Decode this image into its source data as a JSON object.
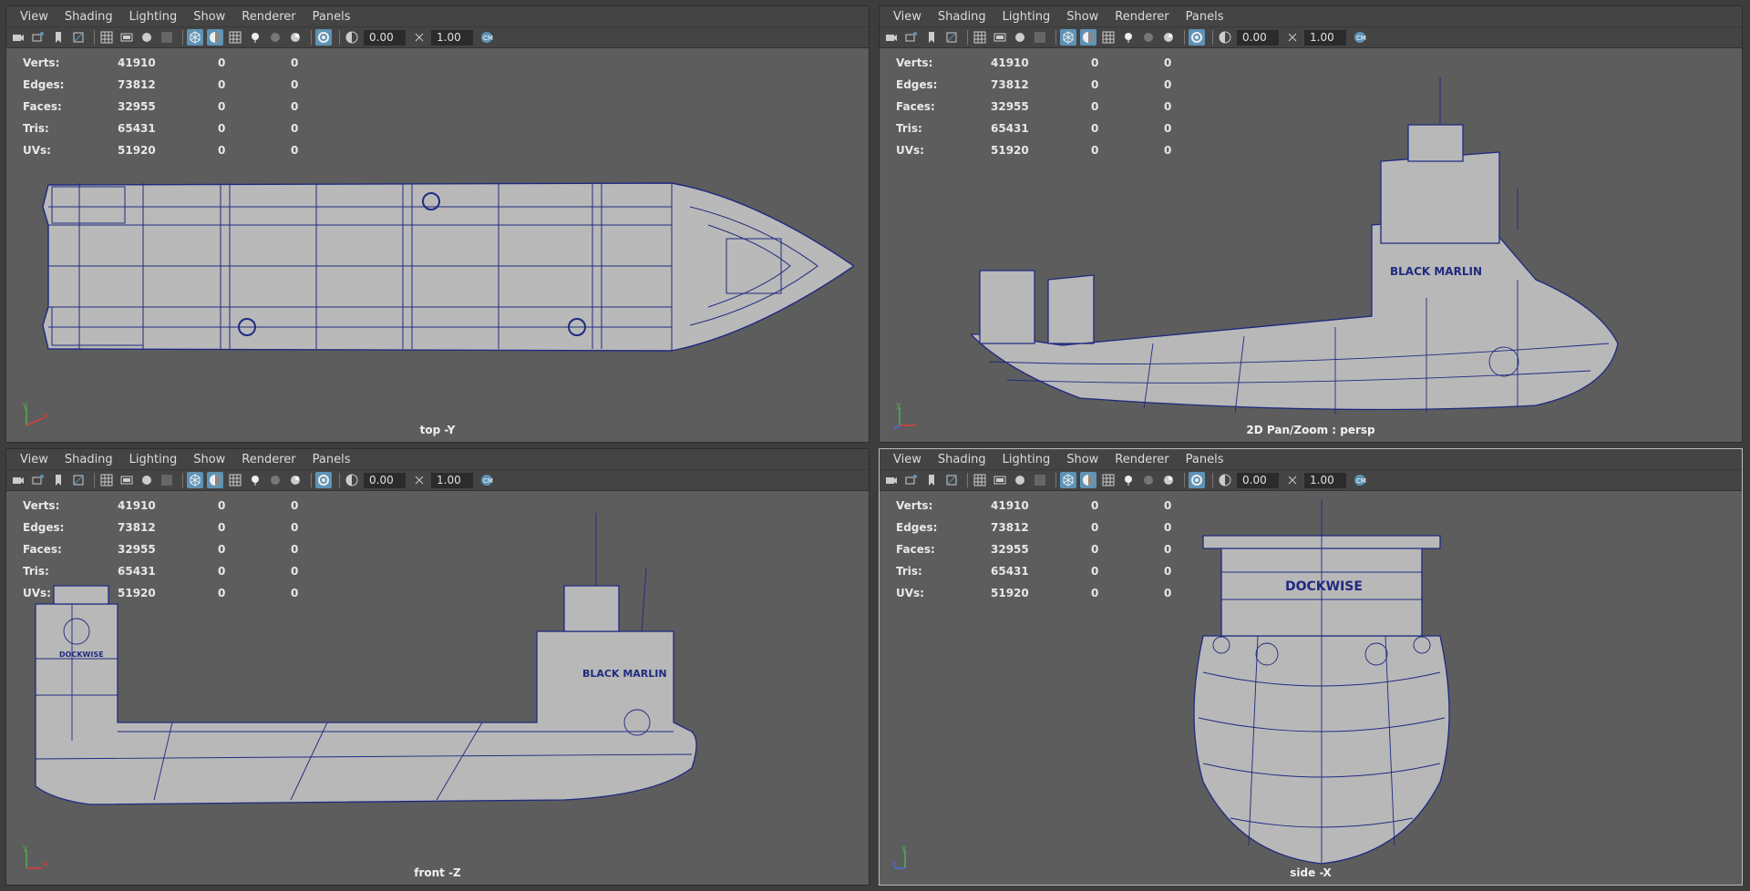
{
  "menu": [
    "View",
    "Shading",
    "Lighting",
    "Show",
    "Renderer",
    "Panels"
  ],
  "toolbar": {
    "field_a": "0.00",
    "field_b": "1.00",
    "icons": [
      "camera-icon",
      "camera-attributes-icon",
      "bookmark-icon",
      "image-plane-icon",
      "grid-icon",
      "film-gate-icon",
      "resolution-gate-icon",
      "safe-action-icon",
      "wireframe-icon",
      "smooth-shade-icon",
      "textured-icon",
      "lights-icon",
      "shadows-icon",
      "xray-icon",
      "isolate-icon",
      "exposure-icon",
      "gamma-icon",
      "color-management-icon"
    ]
  },
  "stats": {
    "labels": [
      "Verts:",
      "Edges:",
      "Faces:",
      "Tris:",
      "UVs:"
    ],
    "values": [
      "41910",
      "73812",
      "32955",
      "65431",
      "51920"
    ],
    "col2": [
      "0",
      "0",
      "0",
      "0",
      "0"
    ],
    "col3": [
      "0",
      "0",
      "0",
      "0",
      "0"
    ]
  },
  "panes": [
    {
      "caption": "top -Y",
      "ship_name": ""
    },
    {
      "caption": "2D Pan/Zoom : persp",
      "ship_name": "BLACK MARLIN"
    },
    {
      "caption": "front -Z",
      "ship_name": "BLACK MARLIN",
      "logo": "DOCKWISE"
    },
    {
      "caption": "side -X",
      "logo": "DOCKWISE"
    }
  ],
  "axis": {
    "x": "x",
    "y": "y"
  },
  "colors": {
    "viewport": "#5d5d5d",
    "wire": "#1f2a80",
    "active_btn": "#5e93b6",
    "panel": "#444444"
  }
}
